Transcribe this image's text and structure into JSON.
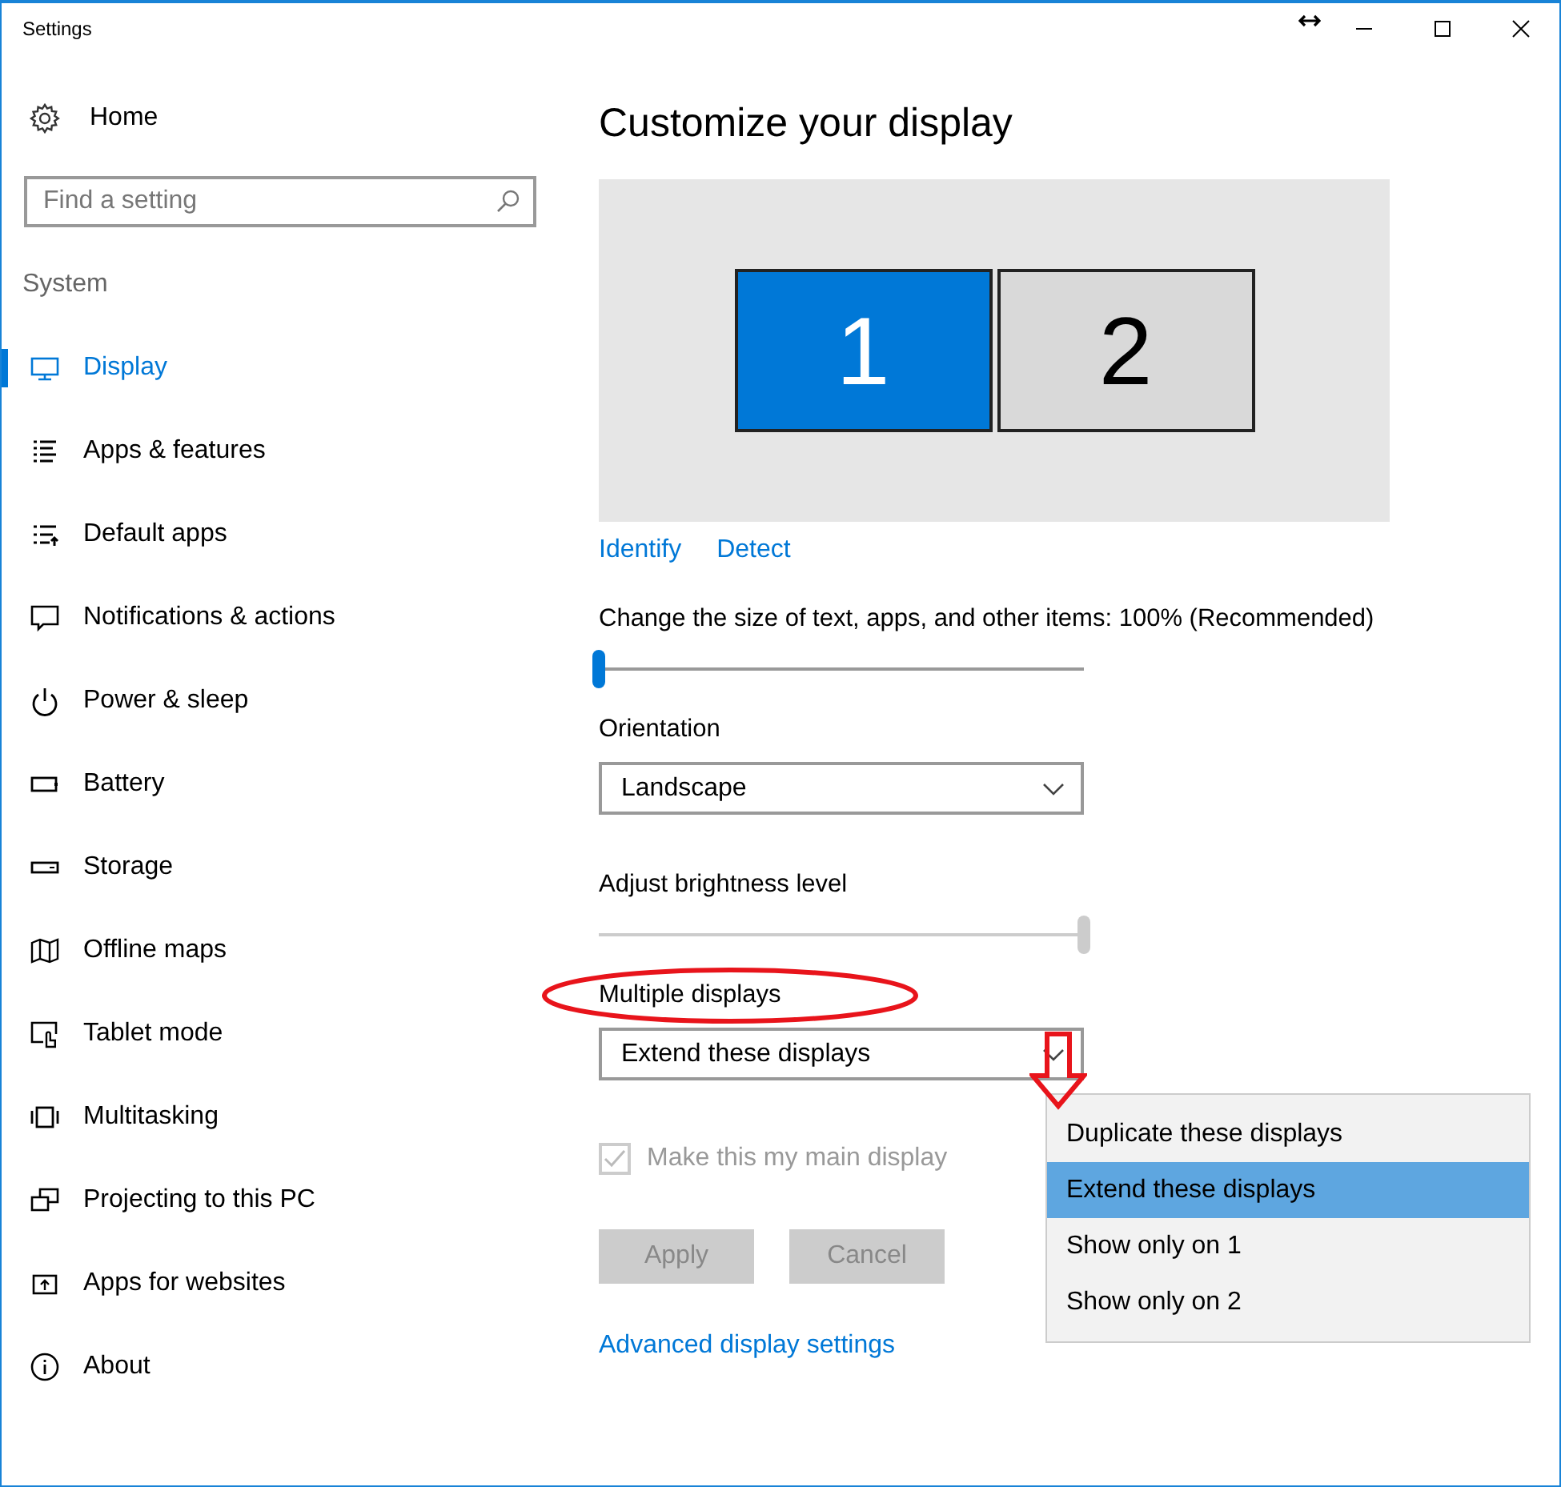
{
  "window": {
    "title": "Settings"
  },
  "sidebar": {
    "home": "Home",
    "search": {
      "placeholder": "Find a setting"
    },
    "section": "System",
    "items": [
      {
        "label": "Display",
        "selected": true
      },
      {
        "label": "Apps & features",
        "selected": false
      },
      {
        "label": "Default apps",
        "selected": false
      },
      {
        "label": "Notifications & actions",
        "selected": false
      },
      {
        "label": "Power & sleep",
        "selected": false
      },
      {
        "label": "Battery",
        "selected": false
      },
      {
        "label": "Storage",
        "selected": false
      },
      {
        "label": "Offline maps",
        "selected": false
      },
      {
        "label": "Tablet mode",
        "selected": false
      },
      {
        "label": "Multitasking",
        "selected": false
      },
      {
        "label": "Projecting to this PC",
        "selected": false
      },
      {
        "label": "Apps for websites",
        "selected": false
      },
      {
        "label": "About",
        "selected": false
      }
    ]
  },
  "main": {
    "heading": "Customize your display",
    "monitors": [
      {
        "label": "1",
        "selected": true
      },
      {
        "label": "2",
        "selected": false
      }
    ],
    "links": [
      "Identify",
      "Detect"
    ],
    "scale": {
      "label": "Change the size of text, apps, and other items: 100% (Recommended)",
      "level": 0
    },
    "orientation": {
      "label": "Orientation",
      "value": "Landscape"
    },
    "brightness": {
      "label": "Adjust brightness level",
      "level": 1,
      "disabled": true
    },
    "multiple": {
      "label": "Multiple displays",
      "value": "Extend these displays",
      "expanded": true,
      "options": [
        {
          "label": "Duplicate these displays",
          "selected": false
        },
        {
          "label": "Extend these displays",
          "selected": true
        },
        {
          "label": "Show only on 1",
          "selected": false
        },
        {
          "label": "Show only on 2",
          "selected": false
        }
      ]
    },
    "main_display": {
      "label": "Make this my main display",
      "checked": true,
      "disabled": true
    },
    "buttons": [
      {
        "label": "Apply",
        "disabled": true
      },
      {
        "label": "Cancel",
        "disabled": true
      }
    ],
    "advanced_link": "Advanced display settings"
  }
}
